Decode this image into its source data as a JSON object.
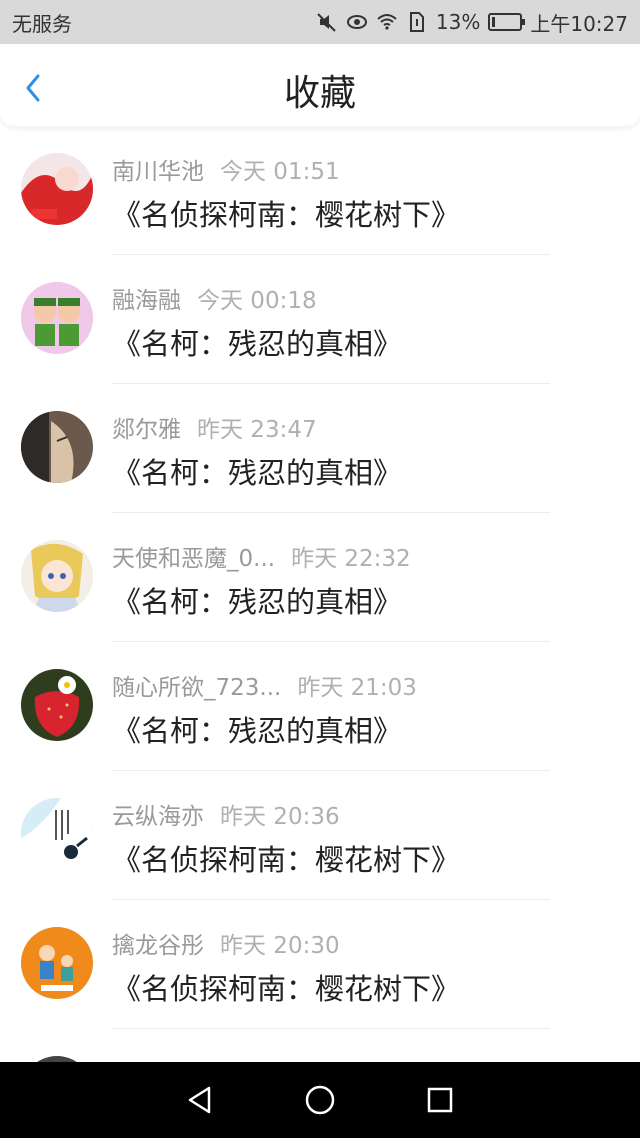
{
  "status_bar": {
    "carrier": "无服务",
    "battery_percent": "13%",
    "time": "上午10:27",
    "battery_level": 0.13,
    "icons": [
      "mute-icon",
      "eye-icon",
      "wifi-icon",
      "sim-icon",
      "battery-icon"
    ]
  },
  "nav": {
    "title": "收藏",
    "back_icon": "chevron-left-icon",
    "accent_color": "#2f8fe8"
  },
  "items": [
    {
      "user": "南川华池",
      "time": "今天 01:51",
      "title": "《名侦探柯南：樱花树下》"
    },
    {
      "user": "融海融",
      "time": "今天 00:18",
      "title": "《名柯：残忍的真相》"
    },
    {
      "user": "郯尔雅",
      "time": "昨天 23:47",
      "title": "《名柯：残忍的真相》"
    },
    {
      "user": "天使和恶魔_0...",
      "time": "昨天 22:32",
      "title": "《名柯：残忍的真相》"
    },
    {
      "user": "随心所欲_723...",
      "time": "昨天 21:03",
      "title": "《名柯：残忍的真相》"
    },
    {
      "user": "云纵海亦",
      "time": "昨天 20:36",
      "title": "《名侦探柯南：樱花树下》"
    },
    {
      "user": "擒龙谷彤",
      "time": "昨天 20:30",
      "title": "《名侦探柯南：樱花树下》"
    }
  ],
  "system_nav": {
    "icons": [
      "back-triangle-icon",
      "home-circle-icon",
      "recents-square-icon"
    ]
  }
}
